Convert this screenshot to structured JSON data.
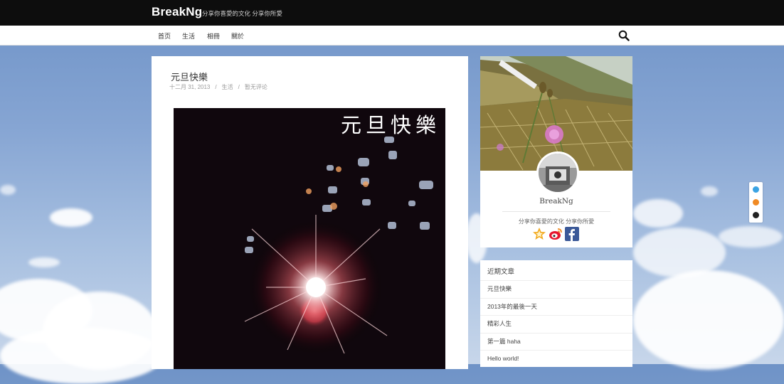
{
  "header": {
    "brand": "BreakNg",
    "tagline": "分享你喜愛的文化 分享你所愛"
  },
  "nav": {
    "items": [
      {
        "label": "首页"
      },
      {
        "label": "生活"
      },
      {
        "label": "相冊"
      },
      {
        "label": "關於"
      }
    ],
    "search_icon": "search-icon"
  },
  "post": {
    "title": "元旦快樂",
    "date": "十二月 31, 2013",
    "separator": "/",
    "category": "生活",
    "comments": "暂无评论",
    "image_caption": "元旦快樂"
  },
  "profile": {
    "name": "BreakNg",
    "tagline": "分享你喜愛的文化 分享你所愛",
    "social": [
      {
        "icon": "star-icon",
        "color": "#f2a81d"
      },
      {
        "icon": "weibo-icon",
        "color": "#e6162d"
      },
      {
        "icon": "facebook-icon",
        "color": "#3b5998"
      }
    ]
  },
  "recent": {
    "heading": "近期文章",
    "items": [
      {
        "label": "元旦快樂"
      },
      {
        "label": "2013年的最後一天"
      },
      {
        "label": "精彩人生"
      },
      {
        "label": "第一篇 haha"
      },
      {
        "label": "Hello world!"
      }
    ]
  },
  "float_tools": [
    {
      "icon": "up-arrow-icon",
      "color": "#3aa3e3"
    },
    {
      "icon": "comment-icon",
      "color": "#f08a24"
    },
    {
      "icon": "down-arrow-icon",
      "color": "#222222"
    }
  ]
}
